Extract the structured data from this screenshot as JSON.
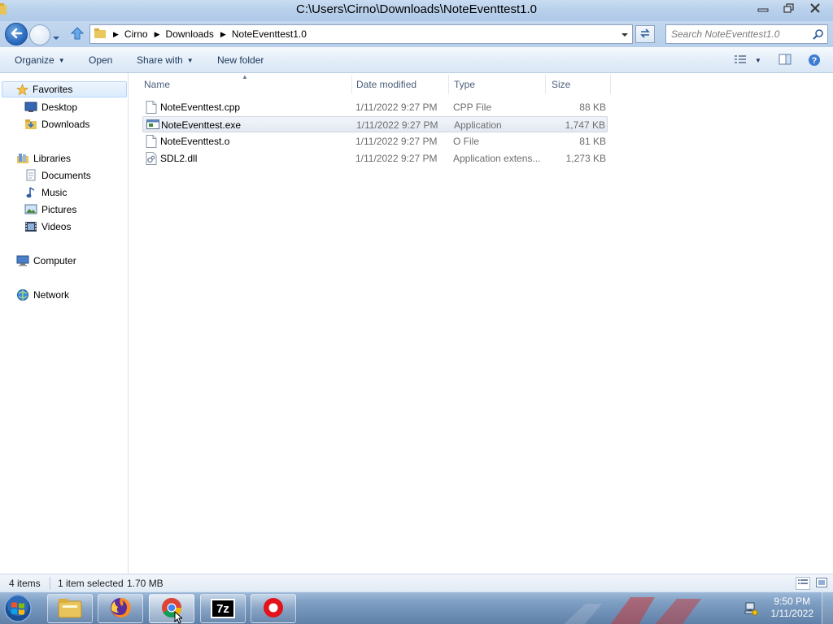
{
  "window": {
    "title": "C:\\Users\\Cirno\\Downloads\\NoteEventtest1.0",
    "controls": {
      "minimize": "minimize-icon",
      "restore": "restore-icon",
      "close": "close-icon"
    }
  },
  "address_bar": {
    "breadcrumbs": [
      "Cirno",
      "Downloads",
      "NoteEventtest1.0"
    ],
    "search_placeholder": "Search NoteEventtest1.0"
  },
  "toolbar": {
    "organize": "Organize",
    "open": "Open",
    "share_with": "Share with",
    "new_folder": "New folder"
  },
  "navigation": {
    "favorites": {
      "label": "Favorites",
      "items": [
        "Desktop",
        "Downloads"
      ]
    },
    "libraries": {
      "label": "Libraries",
      "items": [
        "Documents",
        "Music",
        "Pictures",
        "Videos"
      ]
    },
    "computer": "Computer",
    "network": "Network"
  },
  "file_list": {
    "columns": [
      "Name",
      "Date modified",
      "Type",
      "Size"
    ],
    "rows": [
      {
        "name": "NoteEventtest.cpp",
        "date": "1/11/2022 9:27 PM",
        "type": "CPP File",
        "size": "88 KB",
        "icon": "document-icon",
        "selected": false
      },
      {
        "name": "NoteEventtest.exe",
        "date": "1/11/2022 9:27 PM",
        "type": "Application",
        "size": "1,747 KB",
        "icon": "application-icon",
        "selected": true
      },
      {
        "name": "NoteEventtest.o",
        "date": "1/11/2022 9:27 PM",
        "type": "O File",
        "size": "81 KB",
        "icon": "document-icon",
        "selected": false
      },
      {
        "name": "SDL2.dll",
        "date": "1/11/2022 9:27 PM",
        "type": "Application extens...",
        "size": "1,273 KB",
        "icon": "dll-icon",
        "selected": false
      }
    ]
  },
  "status_bar": {
    "item_count": "4 items",
    "selection": "1 item selected",
    "selection_size": "1.70 MB"
  },
  "taskbar": {
    "apps": [
      "windows-explorer-icon",
      "firefox-icon",
      "chrome-icon",
      "7zip-icon",
      "record-icon"
    ],
    "sevenzip_label": "7z",
    "time": "9:50 PM",
    "date": "1/11/2022"
  },
  "colors": {
    "accent": "#3a6fbf",
    "selection_bg": "#e4e9f1",
    "record_red": "#e3121b"
  }
}
